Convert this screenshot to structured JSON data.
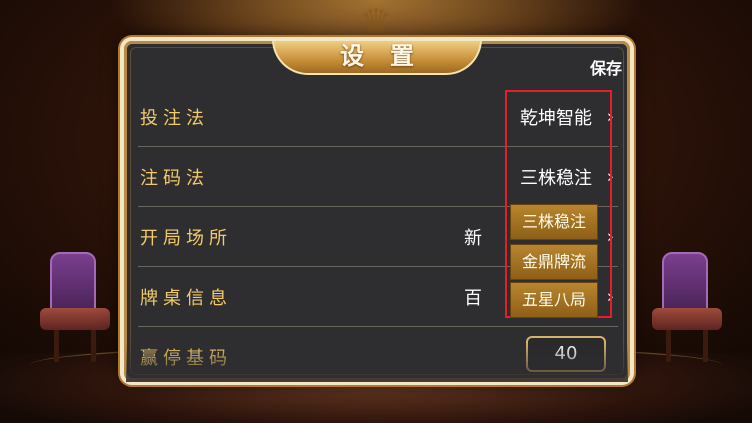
{
  "dialog": {
    "title": "设置",
    "save_label": "保存"
  },
  "rows": [
    {
      "label": "投注法",
      "value": "乾坤智能"
    },
    {
      "label": "注码法",
      "value": "三株稳注"
    },
    {
      "label": "开局场所",
      "value": "新"
    },
    {
      "label": "牌桌信息",
      "value": "百"
    },
    {
      "label": "赢停基码",
      "value": "40"
    }
  ],
  "dropdown": {
    "options": [
      "三株稳注",
      "金鼎牌流",
      "五星八局"
    ],
    "highlight_color": "#e2202a"
  },
  "icons": {
    "chevron": "chevron-right-icon",
    "emblem": "lion-emblem-icon"
  },
  "colors": {
    "label_gold": "#f4cb6a",
    "panel_bg": "#2e2e30",
    "option_gold": "#b8862f"
  }
}
